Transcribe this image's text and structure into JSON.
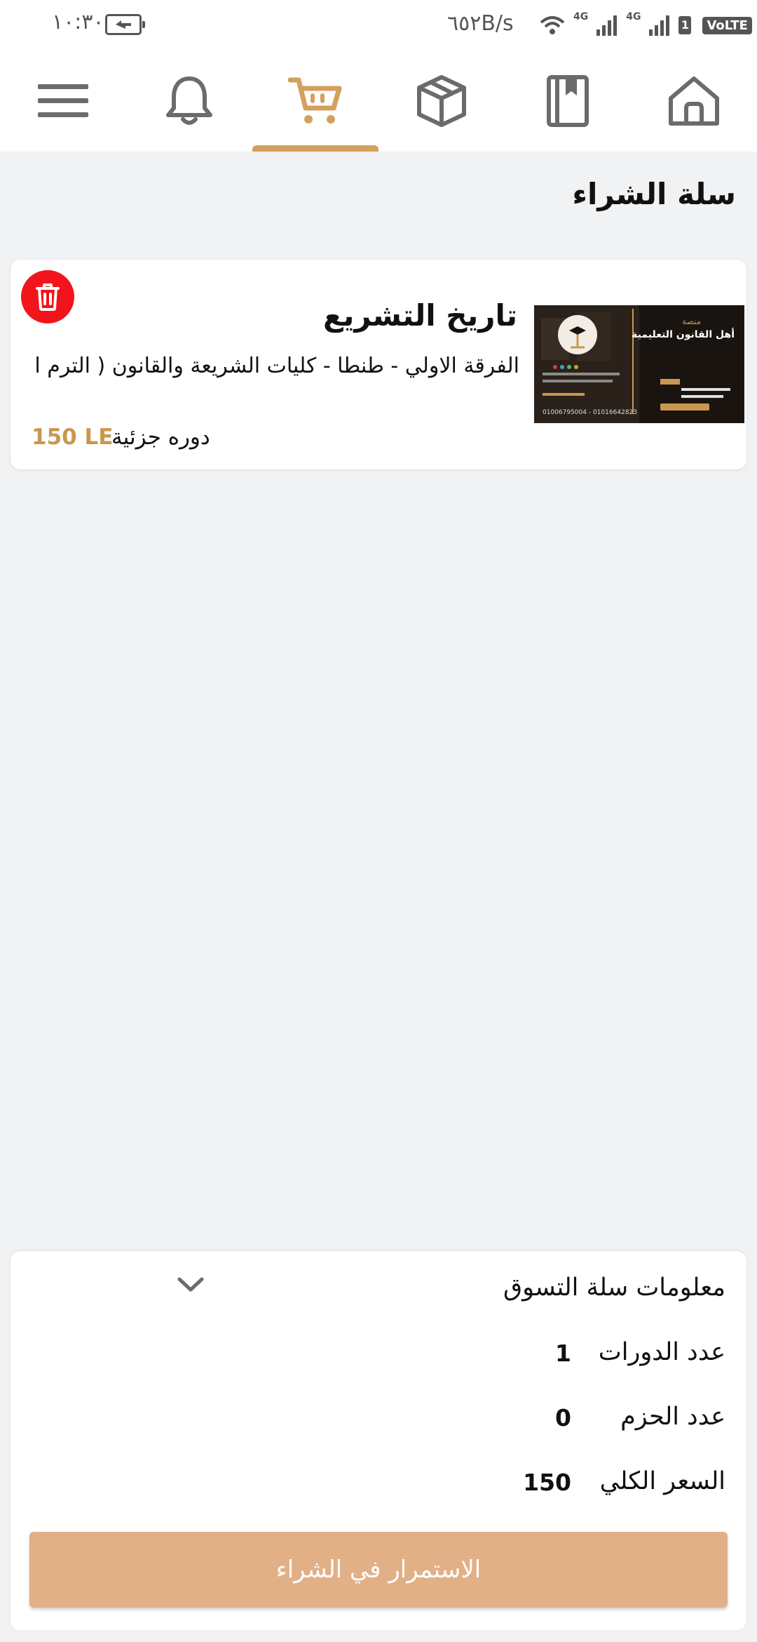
{
  "status_bar": {
    "time": "١٠:٣٠",
    "net_speed": "٦٥٢B/s",
    "network_labels": [
      "4G",
      "4G"
    ],
    "sim_label": "1",
    "volte_label": "VoLTE"
  },
  "nav": {
    "items": [
      {
        "name": "menu",
        "icon": "hamburger-icon"
      },
      {
        "name": "notifications",
        "icon": "bell-icon"
      },
      {
        "name": "cart",
        "icon": "cart-icon",
        "active": true
      },
      {
        "name": "packages",
        "icon": "box-icon"
      },
      {
        "name": "courses",
        "icon": "book-icon"
      },
      {
        "name": "home",
        "icon": "home-icon"
      }
    ],
    "accent_color": "#d4a05f",
    "icon_color": "#6b6b6b"
  },
  "page": {
    "title": "سلة الشراء"
  },
  "cart_item": {
    "title": "تاريخ التشريع",
    "subtitle": "الفرقة الاولي - طنطا - كليات الشريعة والقانون ( الترم الاول )",
    "type": "دوره جزئية",
    "price": "150 LE",
    "thumbnail": {
      "heading_small": "منصة",
      "heading": "أهل القانون التعليمية",
      "phone": "01006795004 - 01016642823"
    }
  },
  "summary": {
    "title": "معلومات سلة التسوق",
    "rows": [
      {
        "label": "عدد الدورات",
        "value": "1"
      },
      {
        "label": "عدد الحزم",
        "value": "0"
      },
      {
        "label": "السعر الكلي",
        "value": "150"
      }
    ],
    "checkout_label": "الاستمرار في الشراء"
  },
  "colors": {
    "background": "#f1f2f4",
    "price": "#c9974f",
    "delete": "#f2141a",
    "checkout_button": "#e2b086"
  }
}
